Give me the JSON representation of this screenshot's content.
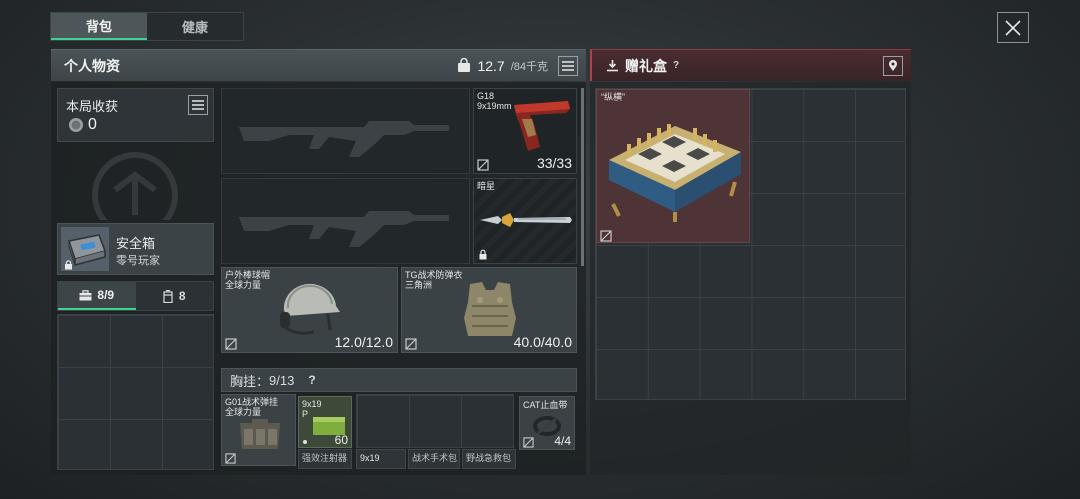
{
  "tabs": [
    {
      "label": "背包"
    },
    {
      "label": "健康"
    }
  ],
  "personal": {
    "title": "个人物资",
    "weight_current": "12.7",
    "weight_max": "/84千克"
  },
  "gift": {
    "title": "赠礼盒",
    "help": "?",
    "item_label": "“纵横”"
  },
  "loot": {
    "label": "本局收获",
    "value": "0"
  },
  "safe_box": {
    "name": "安全箱",
    "sub": "零号玩家"
  },
  "pouch_tabs": [
    {
      "label": "8/9"
    },
    {
      "label": "8"
    }
  ],
  "weapons": {
    "pistol_name": "G18",
    "pistol_ammo_type": "9x19mm",
    "pistol_ammo": "33/33",
    "knife_name": "暗星"
  },
  "helmet": {
    "name": "户外棒球帽",
    "sub": "全球力量",
    "durability": "12.0/12.0"
  },
  "armor": {
    "name": "TG战术防弹衣",
    "sub": "三角洲",
    "durability": "40.0/40.0"
  },
  "chest_rig": {
    "label": "胸挂：",
    "capacity": "9/13",
    "help": "?",
    "rig_name": "G01战术弹挂",
    "rig_sub": "全球力量",
    "ammo_type": "9x19",
    "ammo_grade": "P",
    "ammo_count": "60",
    "ammo2_type": "9x19",
    "cat_name": "CAT止血带",
    "cat_count": "4/4",
    "slot_labels": [
      "强效注射器",
      "战术手术包",
      "野战急救包"
    ]
  }
}
